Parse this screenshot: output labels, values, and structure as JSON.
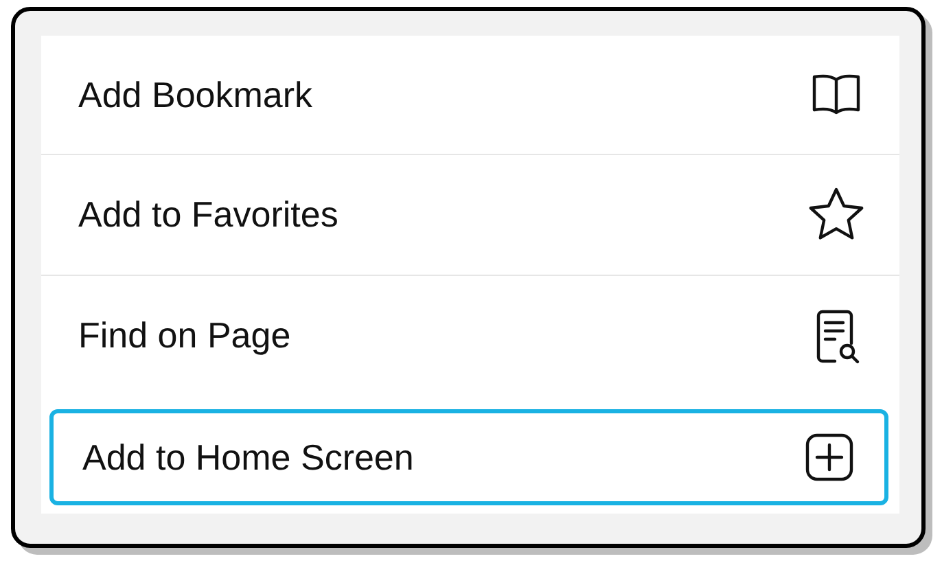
{
  "menu": {
    "items": [
      {
        "label": "Add Bookmark",
        "kind": "bookmark",
        "selected": false
      },
      {
        "label": "Add to Favorites",
        "kind": "favorite",
        "selected": false
      },
      {
        "label": "Find on Page",
        "kind": "find",
        "selected": false
      },
      {
        "label": "Add to Home Screen",
        "kind": "home",
        "selected": true
      }
    ]
  }
}
